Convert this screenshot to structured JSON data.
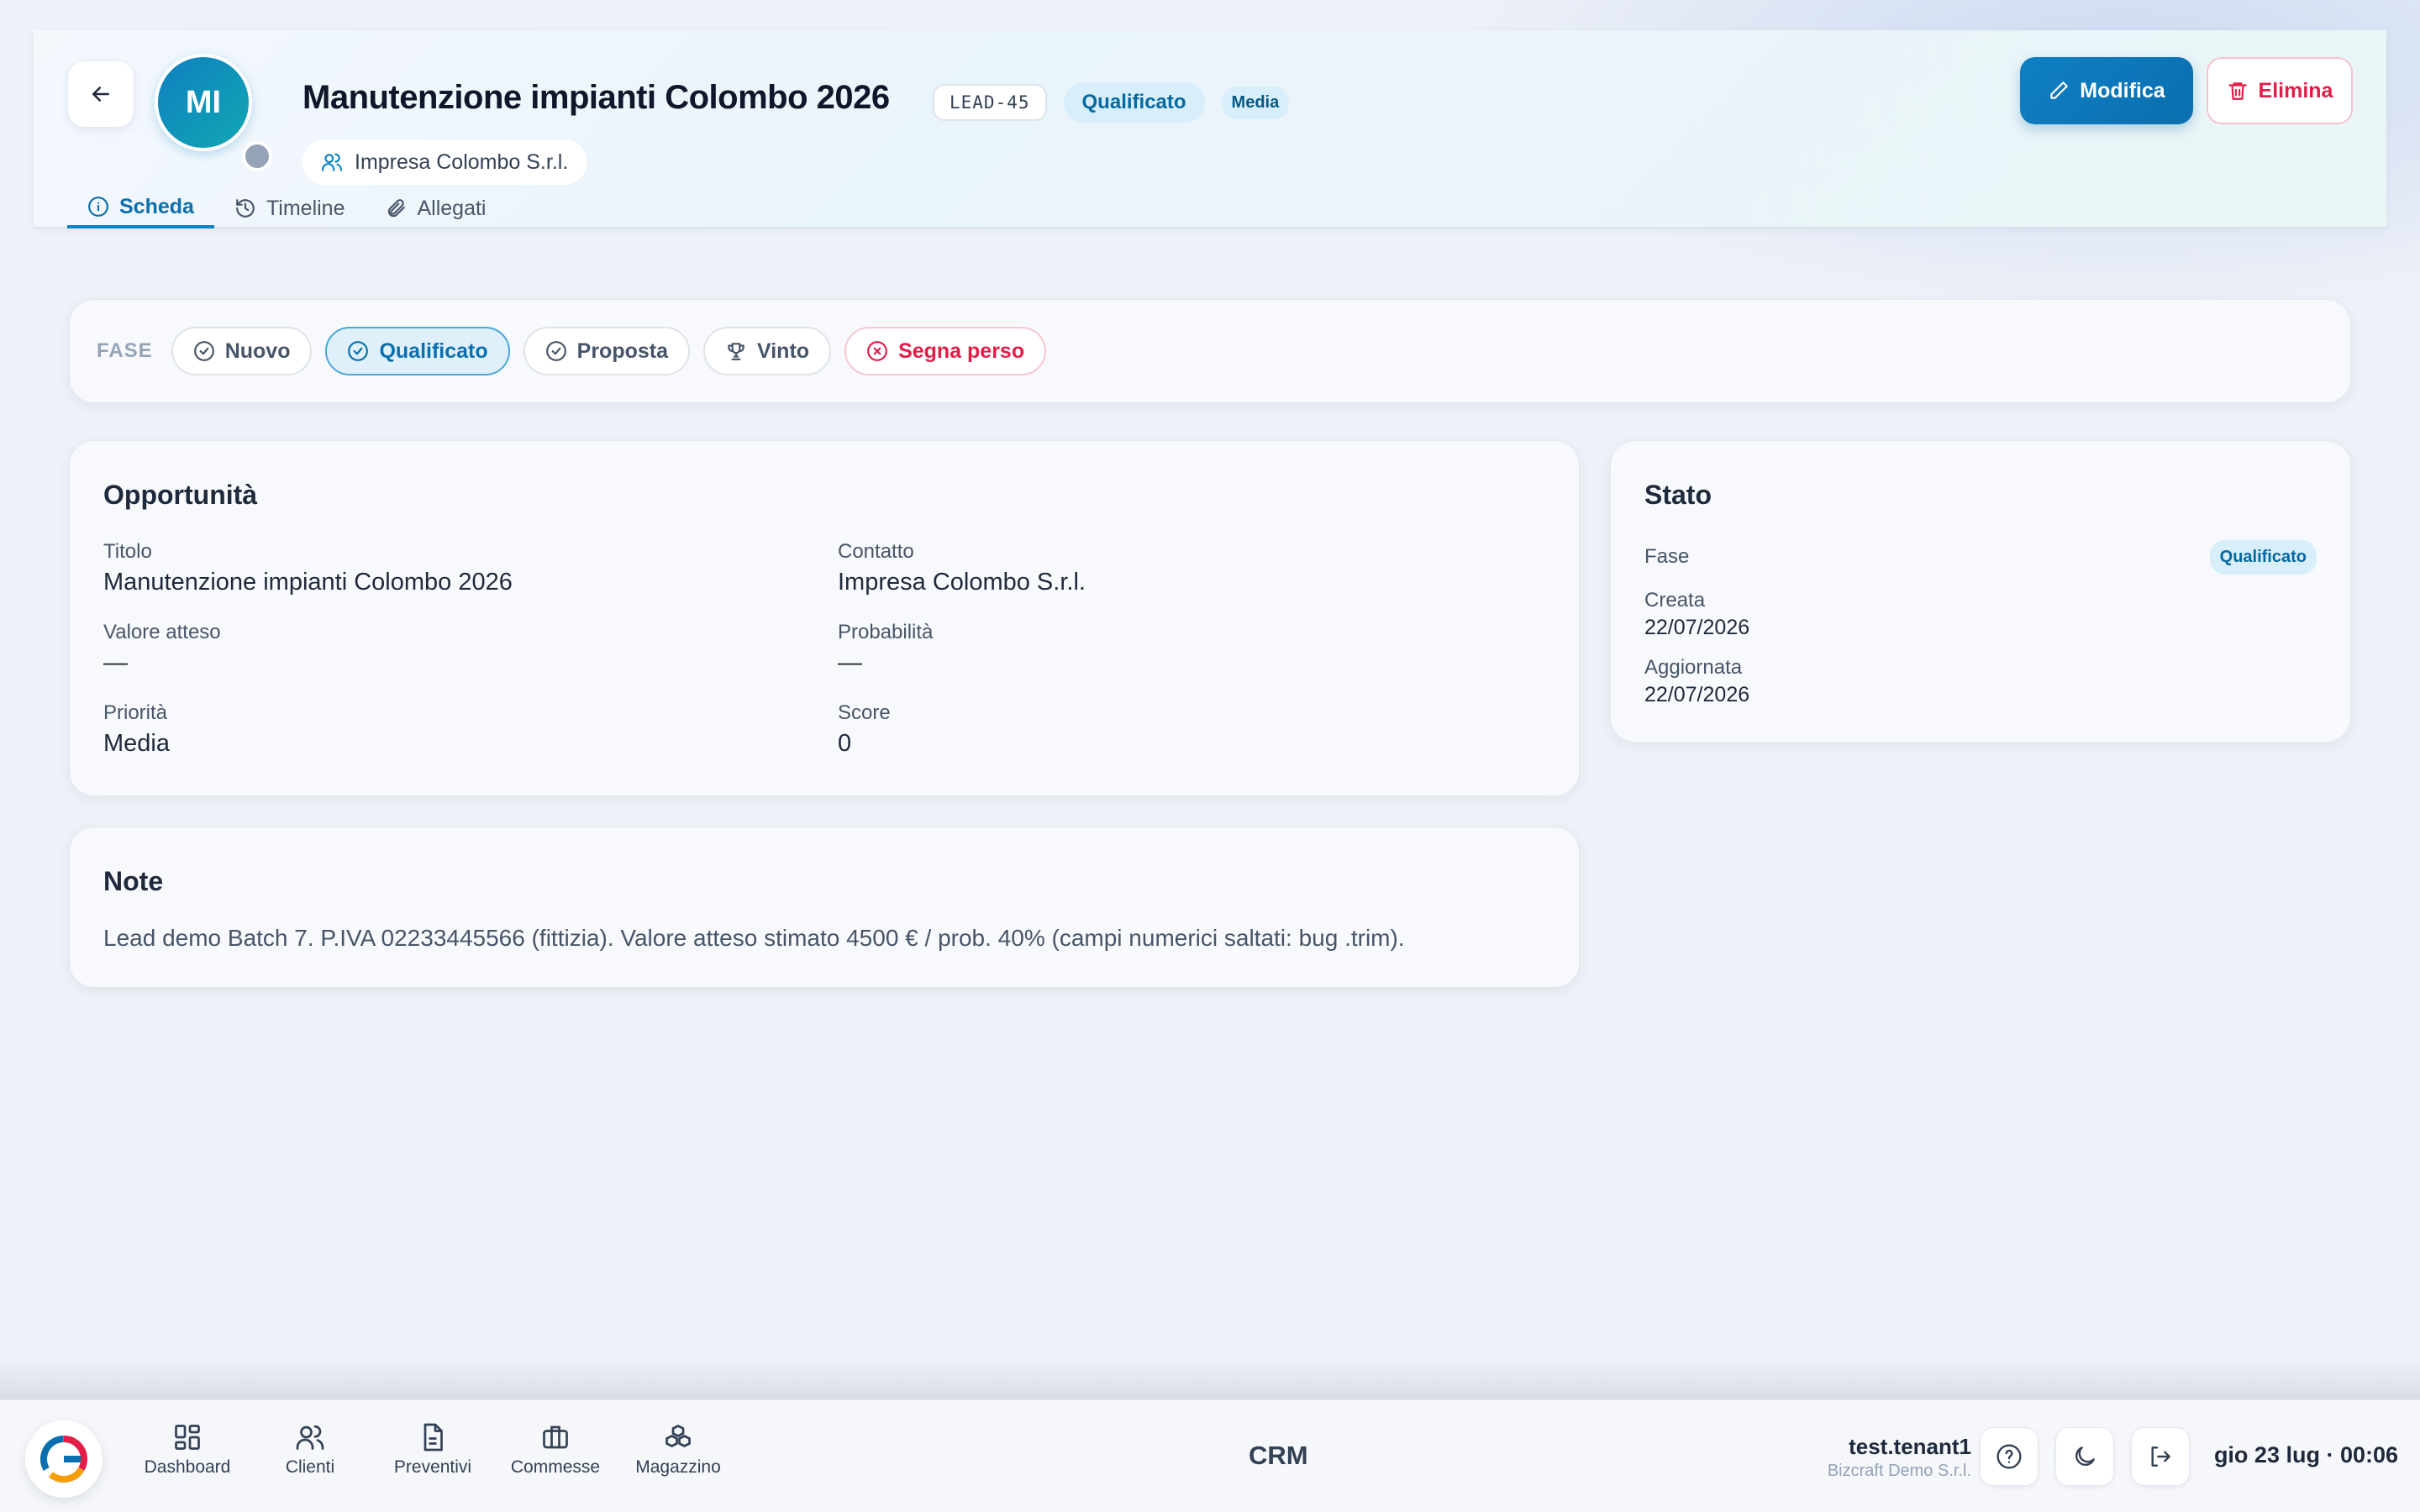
{
  "header": {
    "title": "Manutenzione impianti Colombo 2026",
    "avatar_initials": "MI",
    "code": "LEAD-45",
    "status": "Qualificato",
    "priority": "Media",
    "company": "Impresa Colombo S.r.l.",
    "edit_label": "Modifica",
    "delete_label": "Elimina"
  },
  "tabs": [
    {
      "label": "Scheda",
      "icon": "info-icon",
      "active": true
    },
    {
      "label": "Timeline",
      "icon": "history-icon",
      "active": false
    },
    {
      "label": "Allegati",
      "icon": "paperclip-icon",
      "active": false
    }
  ],
  "phases": {
    "label": "FASE",
    "items": [
      {
        "label": "Nuovo",
        "icon": "check-circle-icon"
      },
      {
        "label": "Qualificato",
        "icon": "check-circle-icon",
        "active": true
      },
      {
        "label": "Proposta",
        "icon": "check-circle-icon"
      },
      {
        "label": "Vinto",
        "icon": "trophy-icon"
      },
      {
        "label": "Segna perso",
        "icon": "x-circle-icon"
      }
    ]
  },
  "opportunity": {
    "title": "Opportunità",
    "fields": {
      "titolo": {
        "label": "Titolo",
        "value": "Manutenzione impianti Colombo 2026"
      },
      "contatto": {
        "label": "Contatto",
        "value": "Impresa Colombo S.r.l."
      },
      "valore": {
        "label": "Valore atteso",
        "value": "—"
      },
      "probabilita": {
        "label": "Probabilità",
        "value": "—"
      },
      "priorita": {
        "label": "Priorità",
        "value": "Media"
      },
      "score": {
        "label": "Score",
        "value": "0"
      }
    }
  },
  "stato": {
    "title": "Stato",
    "fase_label": "Fase",
    "fase_value": "Qualificato",
    "creata_label": "Creata",
    "creata_value": "22/07/2026",
    "aggiornata_label": "Aggiornata",
    "aggiornata_value": "22/07/2026"
  },
  "note": {
    "title": "Note",
    "text": "Lead demo Batch 7. P.IVA 02233445566 (fittizia). Valore atteso stimato 4500 € / prob. 40% (campi numerici saltati: bug .trim)."
  },
  "bottom": {
    "nav": [
      {
        "label": "Dashboard",
        "icon": "dashboard-icon"
      },
      {
        "label": "Clienti",
        "icon": "users-icon"
      },
      {
        "label": "Preventivi",
        "icon": "document-icon"
      },
      {
        "label": "Commesse",
        "icon": "briefcase-icon"
      },
      {
        "label": "Magazzino",
        "icon": "boxes-icon"
      }
    ],
    "module": "CRM",
    "user": "test.tenant1",
    "company": "Bizcraft Demo S.r.l.",
    "clock": "gio 23 lug · 00:06"
  },
  "colors": {
    "accent": "#0a84c6",
    "danger": "#e11d48",
    "background": "#eef1f8"
  }
}
